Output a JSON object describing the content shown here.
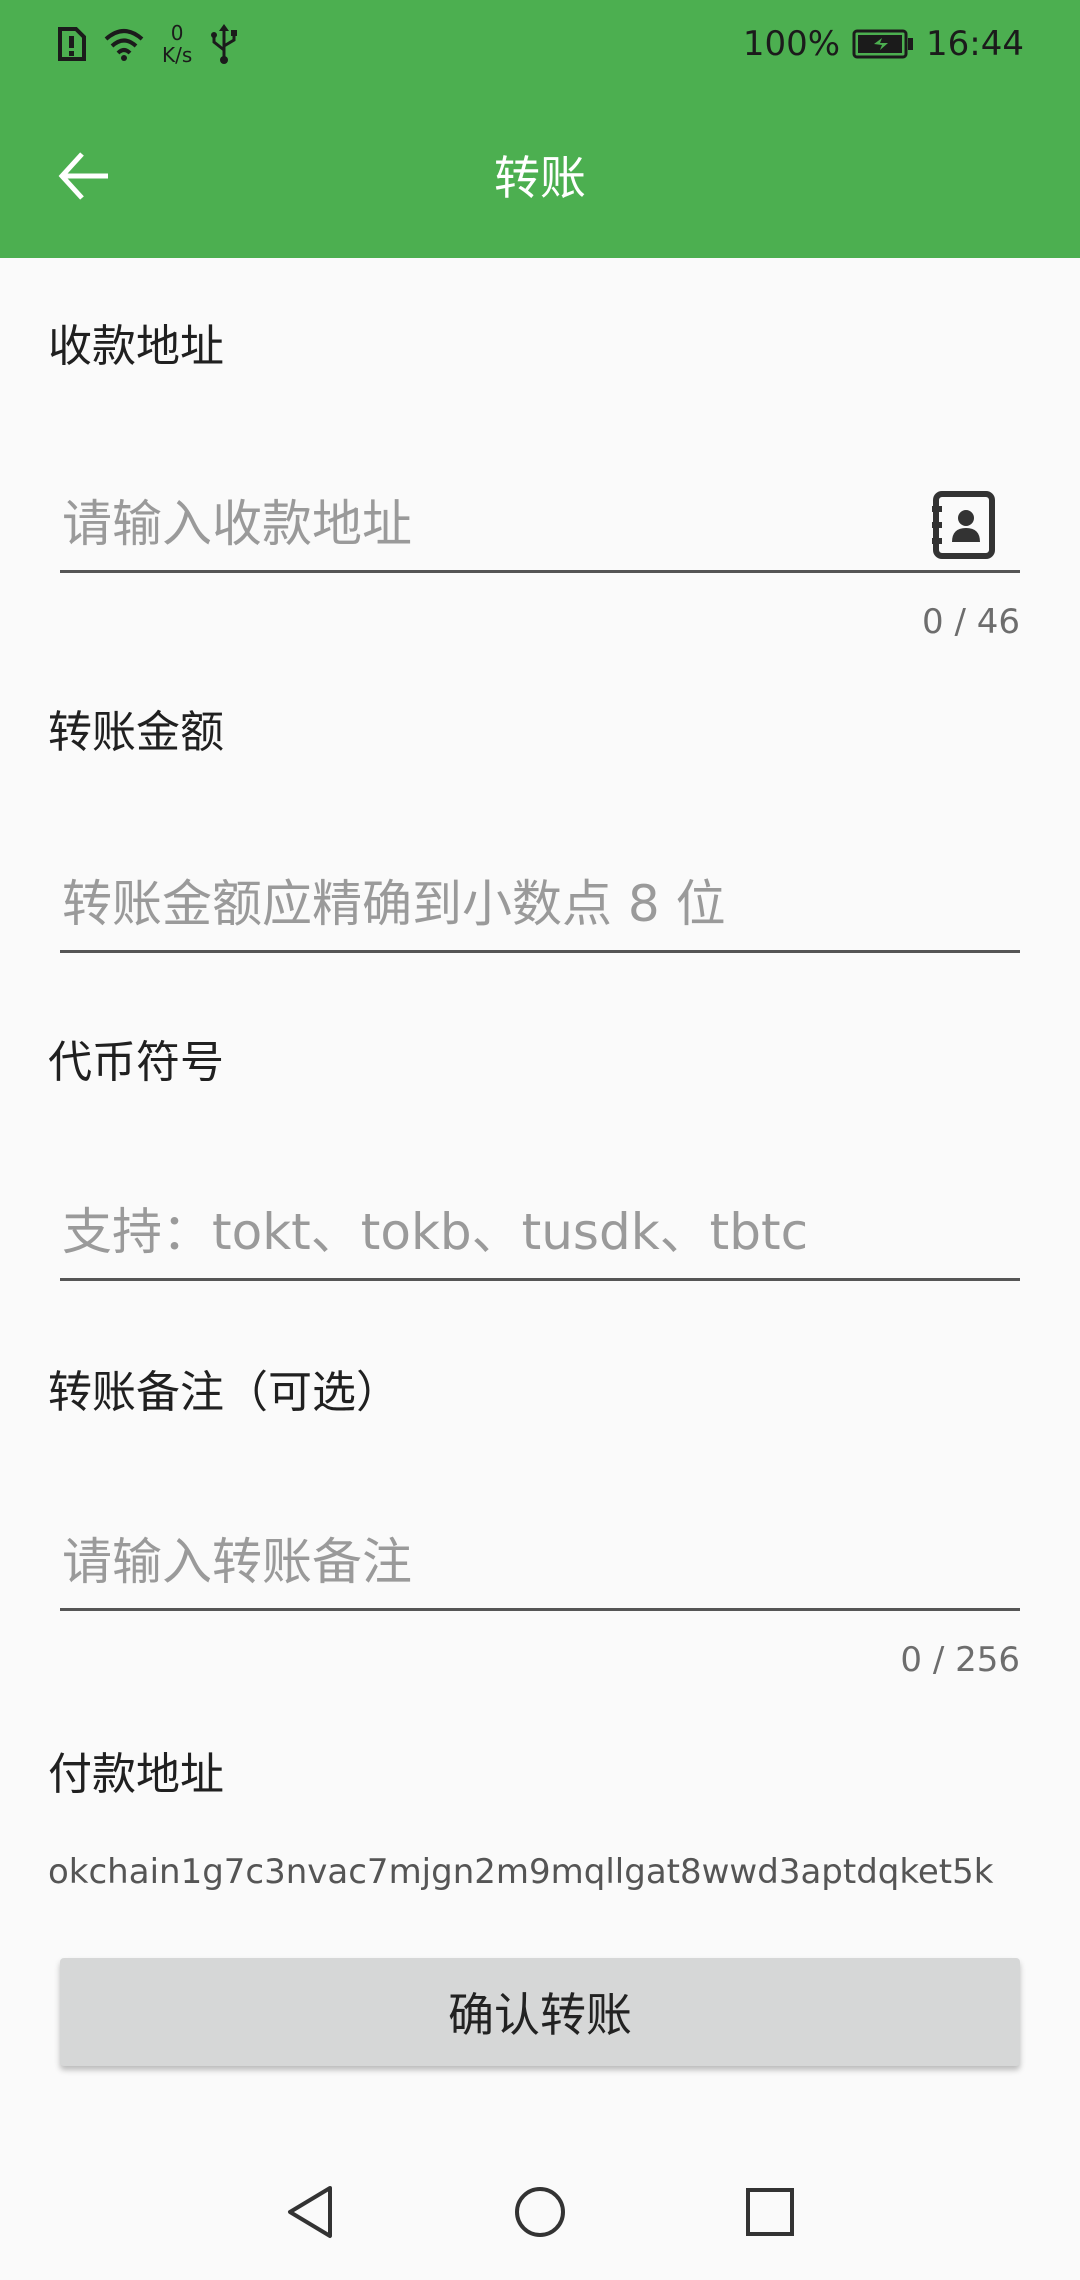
{
  "status_bar": {
    "speed_value": "0",
    "speed_unit": "K/s",
    "battery": "100%",
    "time": "16:44",
    "icons": [
      "alert-sim-icon",
      "wifi-icon",
      "usb-icon",
      "battery-icon"
    ]
  },
  "app_bar": {
    "title": "转账",
    "back_icon": "arrow-left-icon"
  },
  "form": {
    "recipient": {
      "label": "收款地址",
      "placeholder": "请输入收款地址",
      "counter": "0 / 46",
      "icon": "contacts-book-icon"
    },
    "amount": {
      "label": "转账金额",
      "placeholder": "转账金额应精确到小数点 8 位"
    },
    "token": {
      "label": "代币符号",
      "placeholder": "支持：tokt、tokb、tusdk、tbtc"
    },
    "memo": {
      "label": "转账备注（可选）",
      "placeholder": "请输入转账备注",
      "counter": "0 / 256"
    },
    "payer": {
      "label": "付款地址",
      "value": "okchain1g7c3nvac7mjgn2m9mqllgat8wwd3aptdqket5k"
    },
    "submit_label": "确认转账"
  },
  "nav_bar": {
    "icons": [
      "back-triangle-icon",
      "home-circle-icon",
      "recents-square-icon"
    ]
  },
  "colors": {
    "primary": "#4caf50",
    "button": "#d6d7d7",
    "background": "#fafafa"
  }
}
